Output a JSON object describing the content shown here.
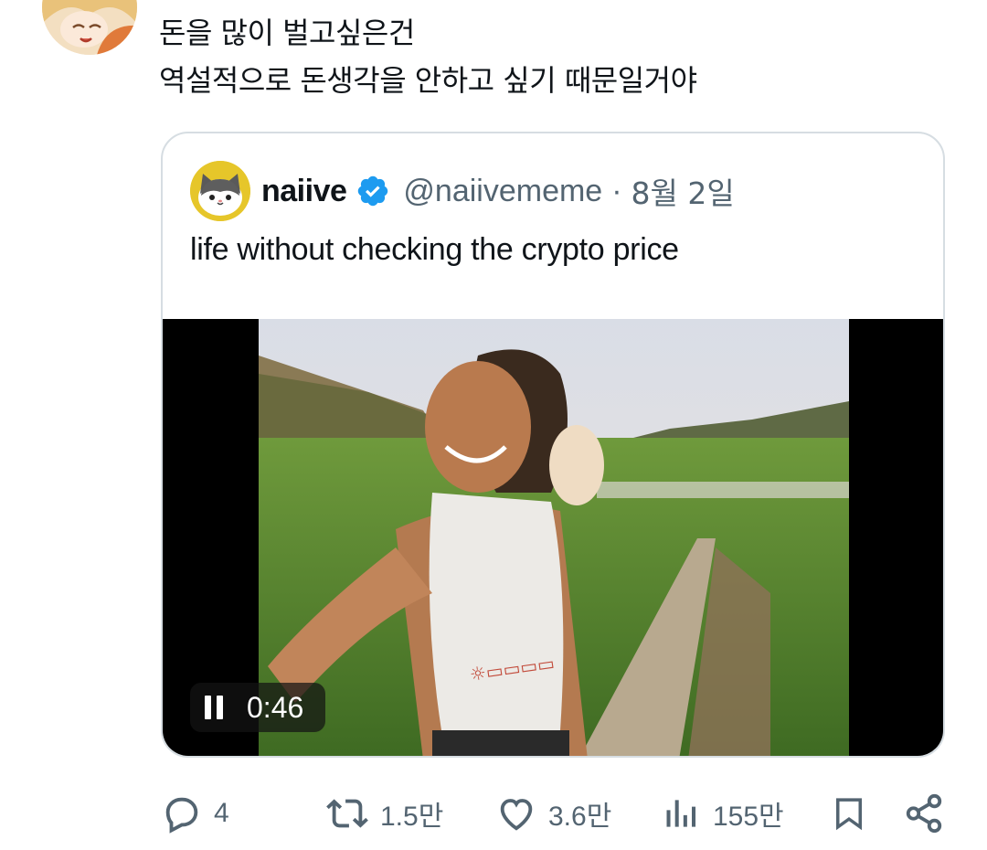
{
  "post": {
    "lines": [
      "돈을 많이 벌고싶은건",
      "역설적으로 돈생각을 안하고 싶기 때문일거야"
    ]
  },
  "quote": {
    "name": "naiive",
    "handle": "@naiivememe",
    "separator": "·",
    "date": "8월 2일",
    "text": "life without checking the crypto price",
    "video": {
      "time": "0:46",
      "state": "playing"
    }
  },
  "actions": {
    "replies": "4",
    "reposts": "1.5만",
    "likes": "3.6만",
    "views": "155만"
  },
  "colors": {
    "accent": "#1d9bf0",
    "muted": "#536471",
    "border": "#d6dde2"
  },
  "icons": [
    "reply-icon",
    "repost-icon",
    "like-icon",
    "views-icon",
    "bookmark-icon",
    "share-icon",
    "verified-badge-icon",
    "pause-icon"
  ]
}
